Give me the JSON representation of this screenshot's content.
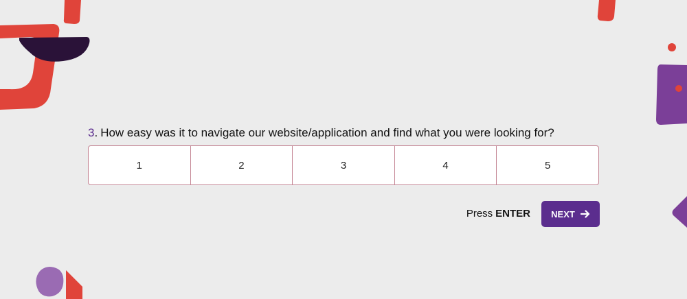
{
  "question": {
    "number": "3",
    "dot": ".",
    "text": "How easy was it to navigate our website/application and find what you were looking for?"
  },
  "scale": {
    "options": [
      "1",
      "2",
      "3",
      "4",
      "5"
    ]
  },
  "actions": {
    "hint_prefix": "Press",
    "hint_key": "ENTER",
    "next_label": "NEXT",
    "next_icon": "arrow-right-icon"
  },
  "colors": {
    "background": "#ececec",
    "accent": "#5b2d8e",
    "scale_border": "#c48594",
    "deco_red": "#e0443a",
    "deco_dark": "#2a1238",
    "deco_purple": "#7b3f98",
    "deco_lavender": "#9a6bb3"
  }
}
